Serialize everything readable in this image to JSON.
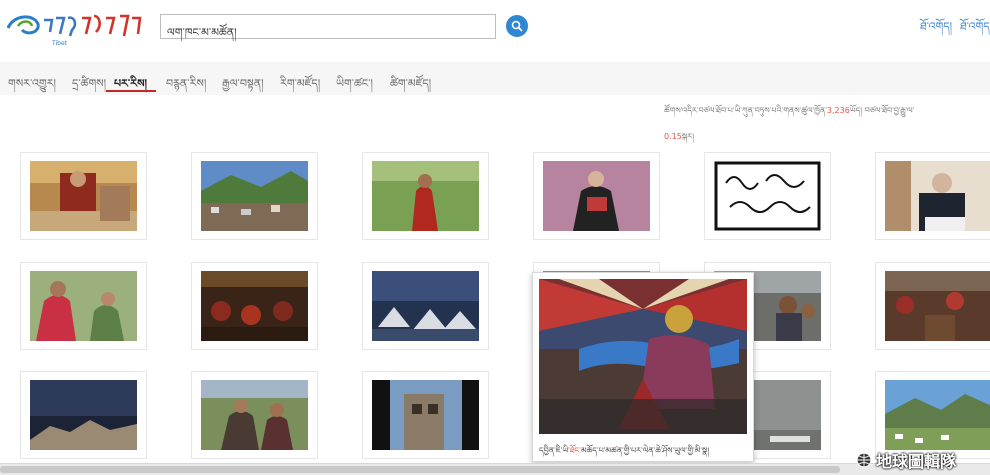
{
  "header": {
    "logo_text": "Tibet",
    "search_value": "ལག་ཁང་མ་མཚོན།",
    "links": [
      "ཐོ་འགོད།",
      "ཐོ་འགོད།"
    ]
  },
  "nav": {
    "items": [
      "གསར་འགྱུར།",
      "དྲ་ཚིགས།",
      "པར་རིས།",
      "བརྙན་རིས།",
      "རྒྱལ་བསྟན།",
      "རིག་མཛོད།",
      "ཡིག་ཚང་།",
      "ཚིག་མཛོད།"
    ],
    "active_index": 2
  },
  "info": {
    "line1_pre": "ཚོགས་འདིར་བཙལ་ཐོབ་པ་ཡི་ཀུན་བཏུས་པའི་གནས་ཚུལ་ཁྱོན་",
    "count": "3,236",
    "line1_post": "ཡོད། བཙལ་ཐོབ་བྱ་རྒྱུ་ལ་",
    "seconds": "0.15",
    "line2_post": "སྐར།"
  },
  "popup": {
    "caption_pre": "དབྱིན་ཇི་ཡི་",
    "caption_red": "ཐོང་",
    "caption_post": "མཆོད་པ་མཚན་གྱི་པར་ལེན་ཆེ་ཤོས་ཡུལ་གྱི་མི་སྣ།"
  },
  "watermark": "地球圖輯隊",
  "colors": {
    "accent_red": "#c52a2a",
    "link_blue": "#3a84cc",
    "search_blue": "#2f86d1"
  }
}
